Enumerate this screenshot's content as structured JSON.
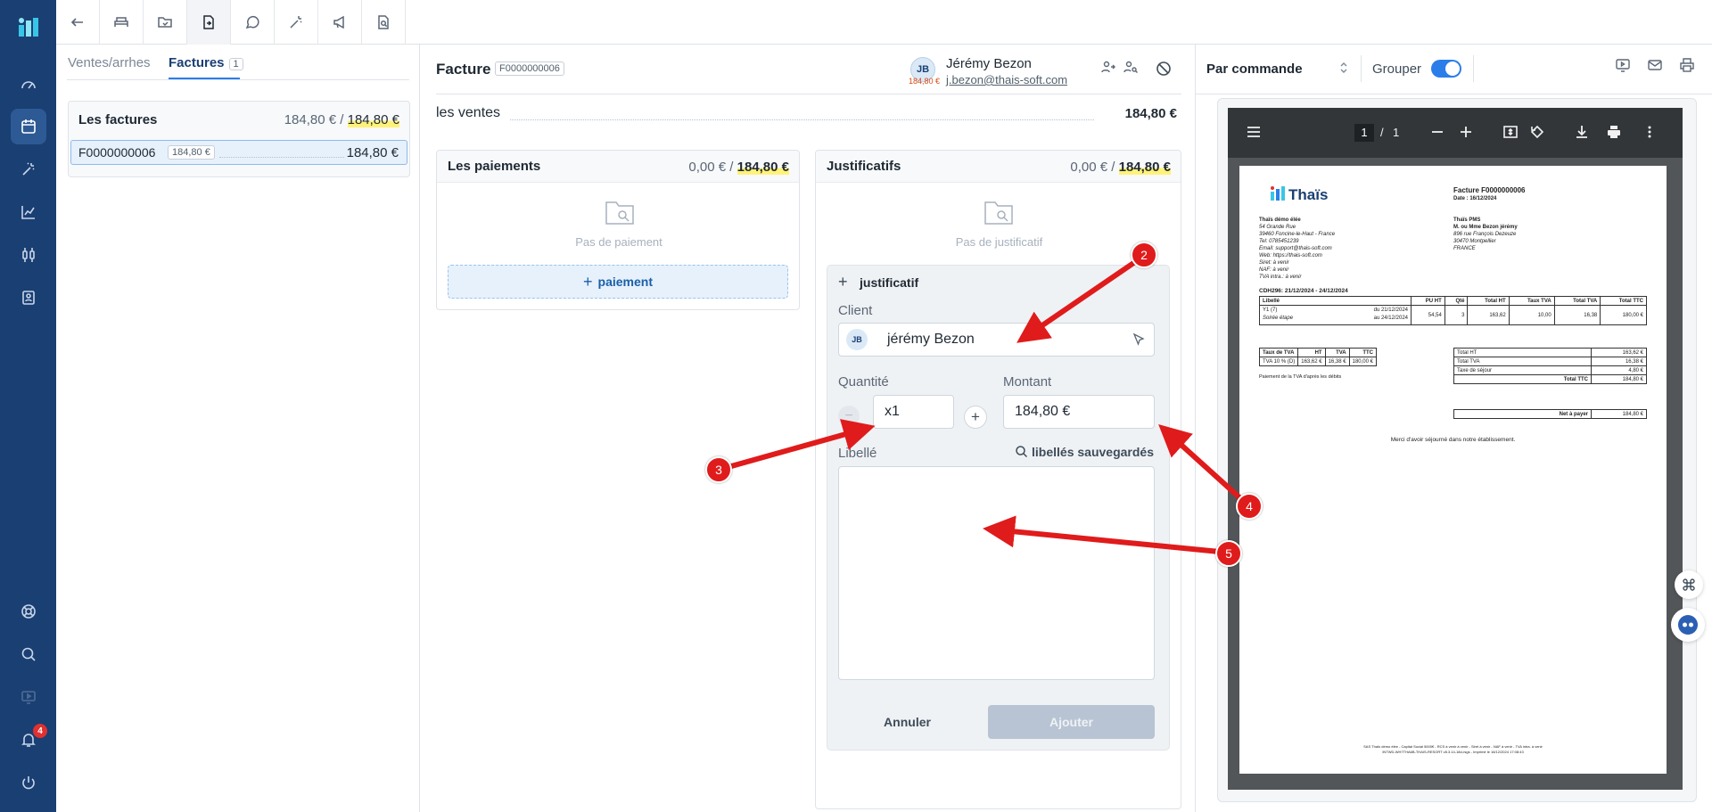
{
  "sidebar": {
    "items": [
      "dashboard-icon",
      "calendar-icon",
      "magic-wand-icon",
      "chart-icon",
      "sliders-icon",
      "contact-card-icon"
    ],
    "bottom_items": [
      "help-icon",
      "search-icon",
      "screen-icon",
      "bell-icon",
      "power-icon"
    ],
    "notification_count": "4"
  },
  "toolbar": {
    "buttons": [
      "back-arrow-icon",
      "bed-icon",
      "folder-icon",
      "invoice-icon",
      "chat-icon",
      "wand-icon",
      "megaphone-icon",
      "search-doc-icon"
    ]
  },
  "panel_list": {
    "tabs": [
      {
        "label": "Ventes/arrhes"
      },
      {
        "label": "Factures",
        "count": "1"
      }
    ],
    "invoices_title": "Les factures",
    "invoices_total_paid": "184,80 €",
    "invoices_sep": "/",
    "invoices_total": "184,80 €",
    "invoice": {
      "number": "F0000000006",
      "badge": "184,80 €",
      "amount": "184,80 €"
    }
  },
  "invoice": {
    "title": "Facture",
    "number": "F0000000006",
    "customer": {
      "initials": "JB",
      "balance": "184,80 €",
      "name": "Jérémy Bezon",
      "email": "j.bezon@thais-soft.com"
    },
    "sales_label": "les ventes",
    "sales_total": "184,80 €"
  },
  "payments": {
    "title": "Les paiements",
    "paid": "0,00 €",
    "sep": "/",
    "total": "184,80 €",
    "empty": "Pas de paiement",
    "add_label": "paiement"
  },
  "justificatifs": {
    "title": "Justificatifs",
    "paid": "0,00 €",
    "sep": "/",
    "total": "184,80 €",
    "empty": "Pas de justificatif",
    "form": {
      "title": "justificatif",
      "client_label": "Client",
      "client_initials": "JB",
      "client_name": "jérémy Bezon",
      "quantity_label": "Quantité",
      "quantity_value": "x1",
      "amount_label": "Montant",
      "amount_value": "184,80 €",
      "libelle_label": "Libellé",
      "saved_labels": "libellés sauvegardés",
      "libelle_value": "",
      "cancel": "Annuler",
      "submit": "Ajouter"
    }
  },
  "preview": {
    "mode": "Par commande",
    "group_label": "Grouper",
    "group_on": true,
    "pdf": {
      "page_current": "1",
      "page_sep": "/",
      "page_total": "1",
      "logo": "Thaïs",
      "doc_title": "Facture F0000000006",
      "doc_date": "Date : 16/12/2024",
      "hotel_lines": [
        "Thaïs démo élée",
        "54 Grande Rue",
        "39460 Foncine-le-Haut - France",
        "Tel: 0785451239",
        "Email: support@thais-soft.com",
        "Web: https://thais-soft.com",
        "Siret: à venir",
        "NAF: à venir",
        "TVA intra.: à venir"
      ],
      "client_lines": [
        "Thaïs PMS",
        "M. ou Mme Bezon jérémy",
        "896 rue François Dezeuze",
        "30470 Montpellier",
        "FRANCE"
      ],
      "stay": "CDH296: 21/12/2024 - 24/12/2024",
      "table_headers": [
        "Libellé",
        "PU HT",
        "Qté",
        "Total HT",
        "Taux TVA",
        "Total TVA",
        "Total TTC"
      ],
      "row_label1": "Y1 (7)",
      "row_label2": "Soirée étape",
      "row_from": "du 21/12/2024",
      "row_to": "au 24/12/2024",
      "row_values": [
        "54,54",
        "3",
        "163,62",
        "10,00",
        "16,38",
        "180,00 €"
      ],
      "vat_headers": [
        "Taux de TVA",
        "HT",
        "TVA",
        "TTC"
      ],
      "vat_row": [
        "TVA 10 % (D)",
        "163,62 €",
        "16,38 €",
        "180,00 €"
      ],
      "vat_note": "Paiement de la TVA d'après les débits",
      "totals": [
        {
          "label": "Total HT",
          "value": "163,62 €"
        },
        {
          "label": "Total TVA",
          "value": "16,38 €"
        },
        {
          "label": "Taxe de séjour",
          "value": "4,80 €"
        },
        {
          "label": "Total TTC",
          "value": "184,80 €"
        }
      ],
      "net_label": "Net à payer",
      "net_value": "184,80 €",
      "thanks": "Merci d'avoir séjourné dans notre établissement.",
      "footer1": "SAS Thaïs démo élée - Capital Social 5000€ - RCS à venir à venir - Siret à venir - NAF à venir - TVA intra. à venir",
      "footer2": "INTWD-WH7THA6B-THAIS-RESORT v8.3.14-18d-rsgs - Imprimé le 16/12/2024 17:08:43"
    }
  },
  "annotations": [
    "2",
    "3",
    "4",
    "5"
  ]
}
